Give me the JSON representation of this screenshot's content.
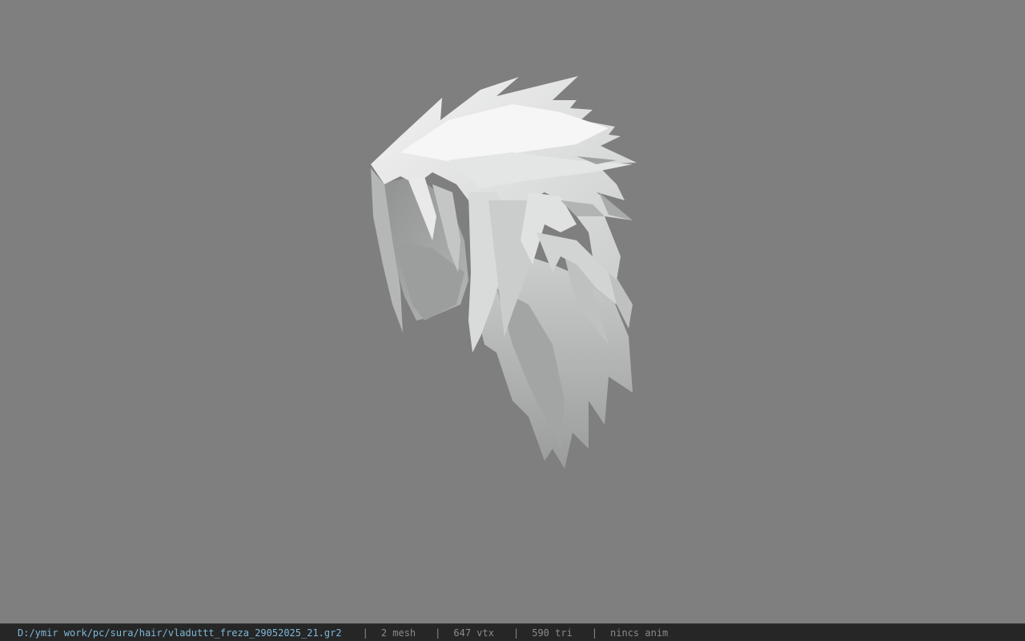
{
  "status_bar": {
    "file_path": "D:/ymir work/pc/sura/hair/vladuttt_freza_29052025_21.gr2",
    "separator": "|",
    "mesh_count": "2 mesh",
    "vertex_count": "647 vtx",
    "triangle_count": "590 tri",
    "animation": "nincs anim"
  },
  "viewport": {
    "background_color": "#7f7f7f",
    "model_color": "#d8dad9"
  }
}
